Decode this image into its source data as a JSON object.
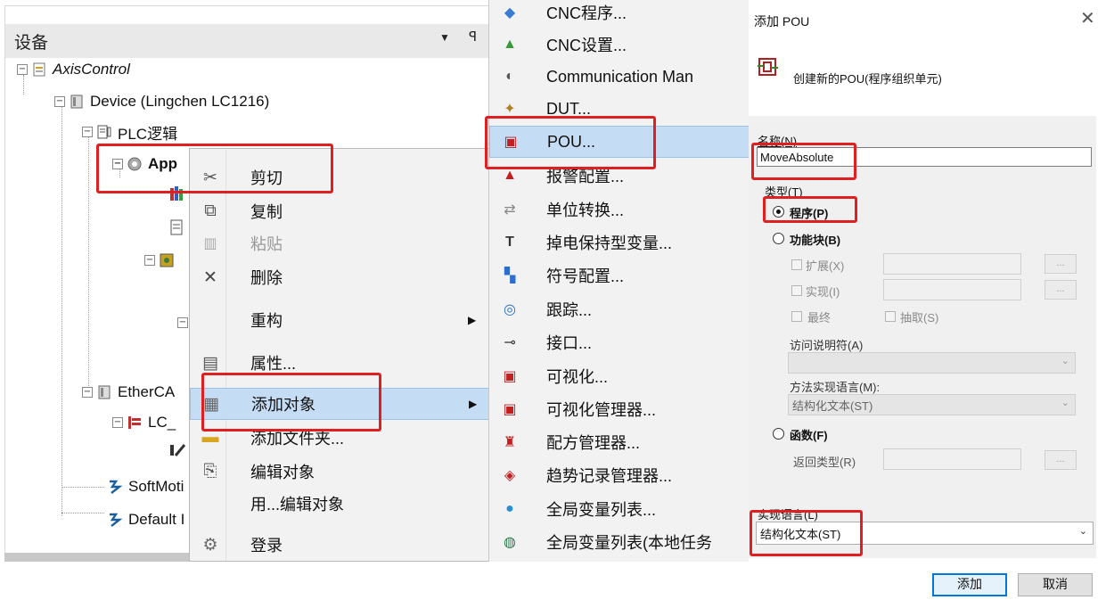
{
  "devices_pane": {
    "title": "设备",
    "tree": [
      {
        "label": "AxisControl",
        "level": 0,
        "expander": "⊟",
        "icon": "project-icon"
      },
      {
        "label": "Device (Lingchen LC1216)",
        "level": 1,
        "expander": "⊟",
        "icon": "device-icon"
      },
      {
        "label": "PLC逻辑",
        "level": 2,
        "expander": "⊟",
        "icon": "plc-logic-icon"
      },
      {
        "label": "App",
        "level": 3,
        "expander": "⊟",
        "icon": "application-gear-icon"
      },
      {
        "label": "EtherCA",
        "level": 2,
        "expander": "⊟",
        "icon": "ethercat-icon"
      },
      {
        "label": "LC_",
        "level": 3,
        "expander": "⊟",
        "icon": "ethercat-slave-icon"
      },
      {
        "label": "SoftMoti",
        "level": 1,
        "icon": "softmotion-icon"
      },
      {
        "label": "Default I",
        "level": 1,
        "icon": "softmotion-icon"
      }
    ]
  },
  "context_menu": {
    "items": [
      {
        "label": "剪切",
        "icon": "scissors-icon",
        "glyph": "✂"
      },
      {
        "label": "复制",
        "icon": "copy-icon",
        "glyph": "⧉"
      },
      {
        "label": "粘贴",
        "icon": "paste-icon",
        "glyph": "📋",
        "disabled": true
      },
      {
        "label": "删除",
        "icon": "delete-icon",
        "glyph": "✕"
      },
      {
        "label": "重构",
        "icon": "",
        "glyph": "",
        "submenu": true
      },
      {
        "label": "属性...",
        "icon": "properties-icon",
        "glyph": "▤"
      },
      {
        "label": "添加对象",
        "icon": "add-object-icon",
        "glyph": "▦",
        "submenu": true,
        "highlighted": true
      },
      {
        "label": "添加文件夹...",
        "icon": "folder-icon",
        "glyph": "▬"
      },
      {
        "label": "编辑对象",
        "icon": "edit-object-icon",
        "glyph": "⎘"
      },
      {
        "label": "用...编辑对象",
        "icon": "",
        "glyph": ""
      },
      {
        "label": "登录",
        "icon": "login-icon",
        "glyph": "⚙"
      }
    ]
  },
  "submenu": {
    "items": [
      {
        "label": "CNC程序...",
        "icon": "cnc-program-icon",
        "glyph": "◆",
        "color": "#3a7bd5"
      },
      {
        "label": "CNC设置...",
        "icon": "cnc-settings-icon",
        "glyph": "▲",
        "color": "#3a9a3a"
      },
      {
        "label": "Communication Man",
        "icon": "communication-icon",
        "glyph": "◐",
        "color": "#555555"
      },
      {
        "label": "DUT...",
        "icon": "dut-icon",
        "glyph": "✦",
        "color": "#b08020"
      },
      {
        "label": "POU...",
        "icon": "pou-icon",
        "glyph": "▣",
        "color": "#c02020",
        "highlighted": true
      },
      {
        "label": "报警配置...",
        "icon": "alarm-icon",
        "glyph": "▲",
        "color": "#c02020"
      },
      {
        "label": "单位转换...",
        "icon": "unit-conversion-icon",
        "glyph": "⇄",
        "color": "#888888"
      },
      {
        "label": "掉电保持型变量...",
        "icon": "persistent-vars-icon",
        "glyph": "T",
        "color": "#333333"
      },
      {
        "label": "符号配置...",
        "icon": "symbol-config-icon",
        "glyph": "▚",
        "color": "#2a6fd0"
      },
      {
        "label": "跟踪...",
        "icon": "trace-icon",
        "glyph": "◎",
        "color": "#2a6fd0"
      },
      {
        "label": "接口...",
        "icon": "interface-icon",
        "glyph": "⊸",
        "color": "#333333"
      },
      {
        "label": "可视化...",
        "icon": "visualization-icon",
        "glyph": "▣",
        "color": "#c02020"
      },
      {
        "label": "可视化管理器...",
        "icon": "visu-manager-icon",
        "glyph": "▣",
        "color": "#c02020"
      },
      {
        "label": "配方管理器...",
        "icon": "recipe-icon",
        "glyph": "♜",
        "color": "#c02020"
      },
      {
        "label": "趋势记录管理器...",
        "icon": "trend-icon",
        "glyph": "◈",
        "color": "#c02020"
      },
      {
        "label": "全局变量列表...",
        "icon": "gvl-icon",
        "glyph": "●",
        "color": "#2a8fd0"
      },
      {
        "label": "全局变量列表(本地任务",
        "icon": "gvl-local-icon",
        "glyph": "◍",
        "color": "#2a7a4a"
      }
    ]
  },
  "dialog": {
    "title": "添加 POU",
    "close": "✕",
    "description": "创建新的POU(程序组织单元)",
    "name_label": "名称(N)",
    "name_value": "MoveAbsolute",
    "type_label": "类型(T)",
    "type_program": "程序(P)",
    "type_function_block": "功能块(B)",
    "extends_label": "扩展(X)",
    "implements_label": "实现(I)",
    "final_label": "最终",
    "abstract_label": "抽取(S)",
    "browse": "...",
    "access_label": "访问说明符(A)",
    "access_value": "",
    "method_lang_label": "方法实现语言(M):",
    "method_lang_value": "结构化文本(ST)",
    "type_function": "函数(F)",
    "return_type_label": "返回类型(R)",
    "impl_lang_label": "实现语言(L)",
    "impl_lang_value": "结构化文本(ST)",
    "add_button": "添加",
    "cancel_button": "取消"
  }
}
